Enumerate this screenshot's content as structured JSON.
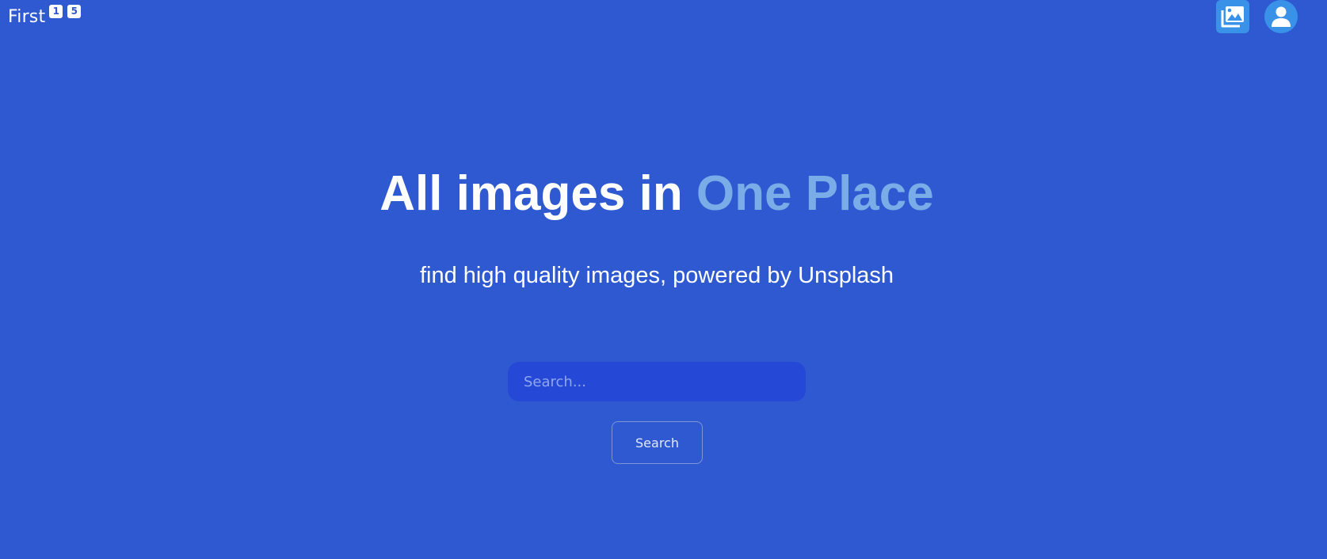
{
  "header": {
    "logo_text": "First",
    "logo_badges": [
      "1",
      "5"
    ],
    "gallery_icon": "image-gallery-icon",
    "avatar_icon": "user-avatar-icon"
  },
  "hero": {
    "title_main": "All images in ",
    "title_accent": "One Place",
    "subtitle": "find high quality images, powered by Unsplash"
  },
  "search": {
    "placeholder": "Search...",
    "button_label": "Search"
  },
  "colors": {
    "background": "#2f59d1",
    "accent_text": "#7aace8",
    "icon_button": "#3a92e8",
    "input_background": "#2549d6"
  }
}
